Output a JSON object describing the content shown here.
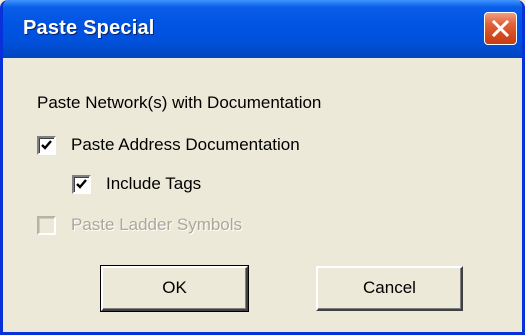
{
  "window": {
    "title": "Paste Special",
    "close_icon": "close-x-icon"
  },
  "dialog": {
    "heading": "Paste Network(s) with Documentation",
    "options": [
      {
        "label": "Paste Address Documentation",
        "checked": true,
        "enabled": true
      },
      {
        "label": "Include Tags",
        "checked": true,
        "enabled": true
      },
      {
        "label": "Paste Ladder Symbols",
        "checked": false,
        "enabled": false
      }
    ],
    "buttons": {
      "ok": "OK",
      "cancel": "Cancel"
    }
  },
  "colors": {
    "titlebar": "#0054e3",
    "face": "#ece9d8",
    "close": "#d44a1e",
    "disabled_text": "#aca899"
  }
}
